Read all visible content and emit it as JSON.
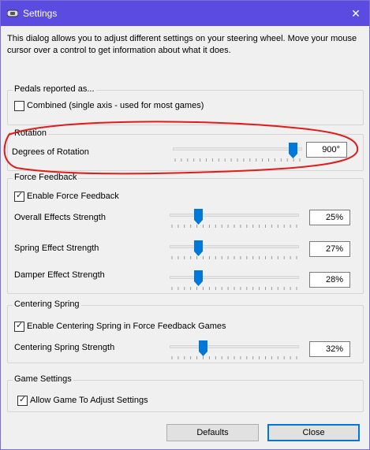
{
  "window": {
    "title": "Settings",
    "close_glyph": "✕",
    "icon": "steering-wheel-icon",
    "titlebar_color": "#5b4be0",
    "accent_color": "#0078d7",
    "annotation_color": "#e11b1b"
  },
  "intro_text": "This dialog allows you to adjust different settings on your steering wheel.  Move your mouse cursor over a control to get information about what it does.",
  "pedals": {
    "legend": "Pedals reported as...",
    "combined_label": "Combined (single axis - used for most games)",
    "combined_checked": false
  },
  "rotation": {
    "legend": "Rotation",
    "degrees_label": "Degrees of Rotation",
    "degrees_value": "900°",
    "slider_fraction": 0.96
  },
  "force_feedback": {
    "legend": "Force Feedback",
    "enable_label": "Enable Force Feedback",
    "enable_checked": true,
    "overall_label": "Overall Effects Strength",
    "overall_value": "25%",
    "overall_fraction": 0.2,
    "spring_label": "Spring Effect Strength",
    "spring_value": "27%",
    "spring_fraction": 0.2,
    "damper_label": "Damper Effect Strength",
    "damper_value": "28%",
    "damper_fraction": 0.2
  },
  "centering": {
    "legend": "Centering Spring",
    "enable_label": "Enable Centering Spring in Force Feedback Games",
    "enable_checked": true,
    "strength_label": "Centering Spring Strength",
    "strength_value": "32%",
    "strength_fraction": 0.24
  },
  "game_settings": {
    "legend": "Game Settings",
    "allow_label": "Allow Game To Adjust Settings",
    "allow_checked": true
  },
  "buttons": {
    "defaults_label": "Defaults",
    "close_label": "Close"
  }
}
